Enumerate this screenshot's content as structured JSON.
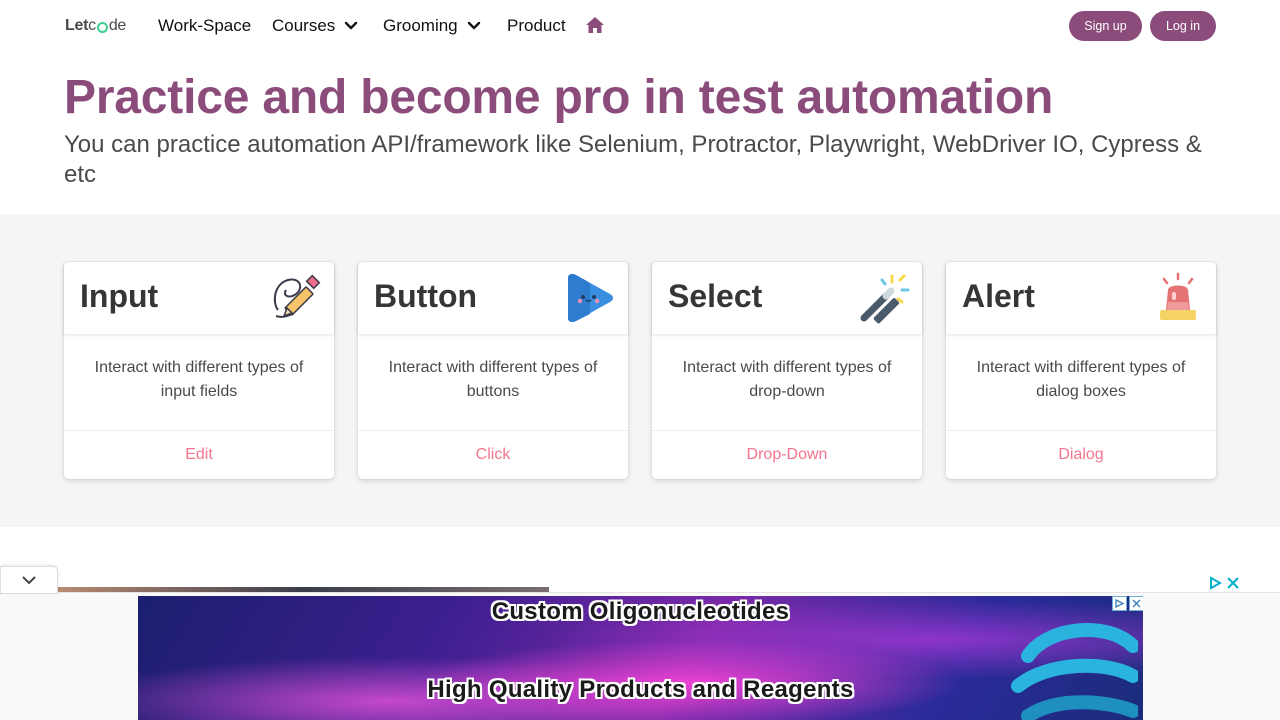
{
  "nav": {
    "logo": {
      "let": "Let",
      "c": "c",
      "de": "de"
    },
    "items": [
      "Work-Space",
      "Courses",
      "Grooming",
      "Product"
    ],
    "signup": "Sign up",
    "login": "Log in"
  },
  "hero": {
    "title": "Practice and become pro in test automation",
    "subtitle": "You can practice automation API/framework like Selenium, Protractor, Playwright, WebDriver IO, Cypress & etc"
  },
  "cards": [
    {
      "title": "Input",
      "description": "Interact with different types of input fields",
      "link": "Edit",
      "icon": "pencil-icon"
    },
    {
      "title": "Button",
      "description": "Interact with different types of buttons",
      "link": "Click",
      "icon": "play-button-icon"
    },
    {
      "title": "Select",
      "description": "Interact with different types of drop-down",
      "link": "Drop-Down",
      "icon": "magic-wand-icon"
    },
    {
      "title": "Alert",
      "description": "Interact with different types of dialog boxes",
      "link": "Dialog",
      "icon": "siren-icon"
    }
  ],
  "ad": {
    "line1": "Custom Oligonucleotides",
    "line2": "High Quality Products and Reagents"
  },
  "colors": {
    "brand": "#8b4c7c",
    "link": "#f14668",
    "section_bg": "#f5f5f5"
  }
}
